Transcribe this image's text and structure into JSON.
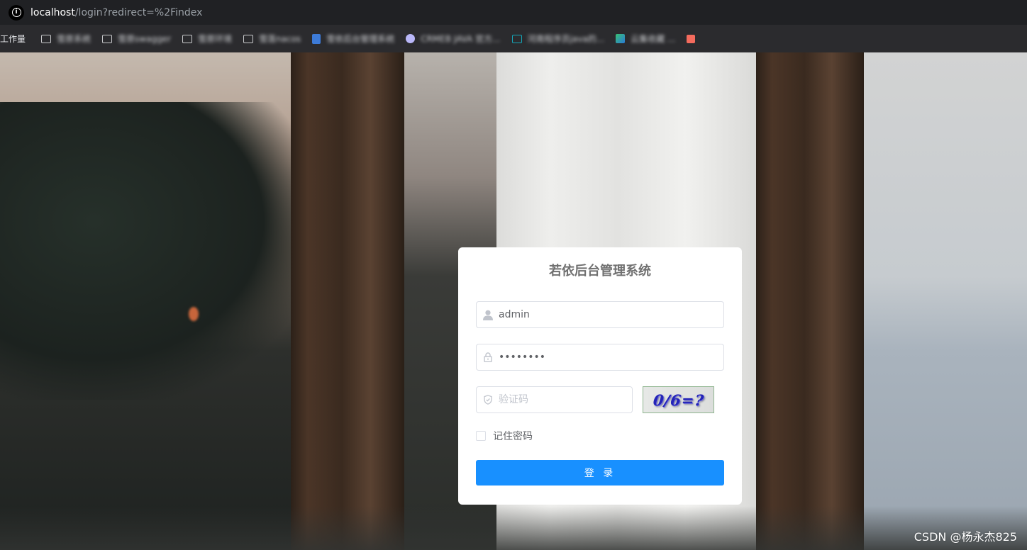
{
  "browser": {
    "url_host": "localhost",
    "url_path": "/login?redirect=%2Findex",
    "bookmarks": [
      {
        "label": "工作量",
        "icon": "none"
      },
      {
        "label": "雪原系统",
        "icon": "folder-icon"
      },
      {
        "label": "雪原swagger",
        "icon": "folder-icon"
      },
      {
        "label": "雪原环境",
        "icon": "folder-icon"
      },
      {
        "label": "雪莲nacos",
        "icon": "folder-icon"
      },
      {
        "label": "雪依后台管理系统",
        "icon": "bookmark-page-icon"
      },
      {
        "label": "CRMEB JAVA 官方...",
        "icon": "globe-icon"
      },
      {
        "label": "河南程序员java的...",
        "icon": "tv-icon"
      },
      {
        "label": "云集收藏 ...",
        "icon": "app-icon"
      },
      {
        "label": "",
        "icon": "red-square-icon"
      }
    ]
  },
  "login": {
    "title": "若依后台管理系统",
    "username_value": "admin",
    "password_value": "admin123",
    "code_placeholder": "验证码",
    "captcha_text": "0/6=?",
    "remember_label": "记住密码",
    "submit_label": "登 录"
  },
  "watermark": "CSDN @杨永杰825",
  "colors": {
    "primary": "#1890ff",
    "card_bg": "#ffffff",
    "title_text": "#707070"
  }
}
